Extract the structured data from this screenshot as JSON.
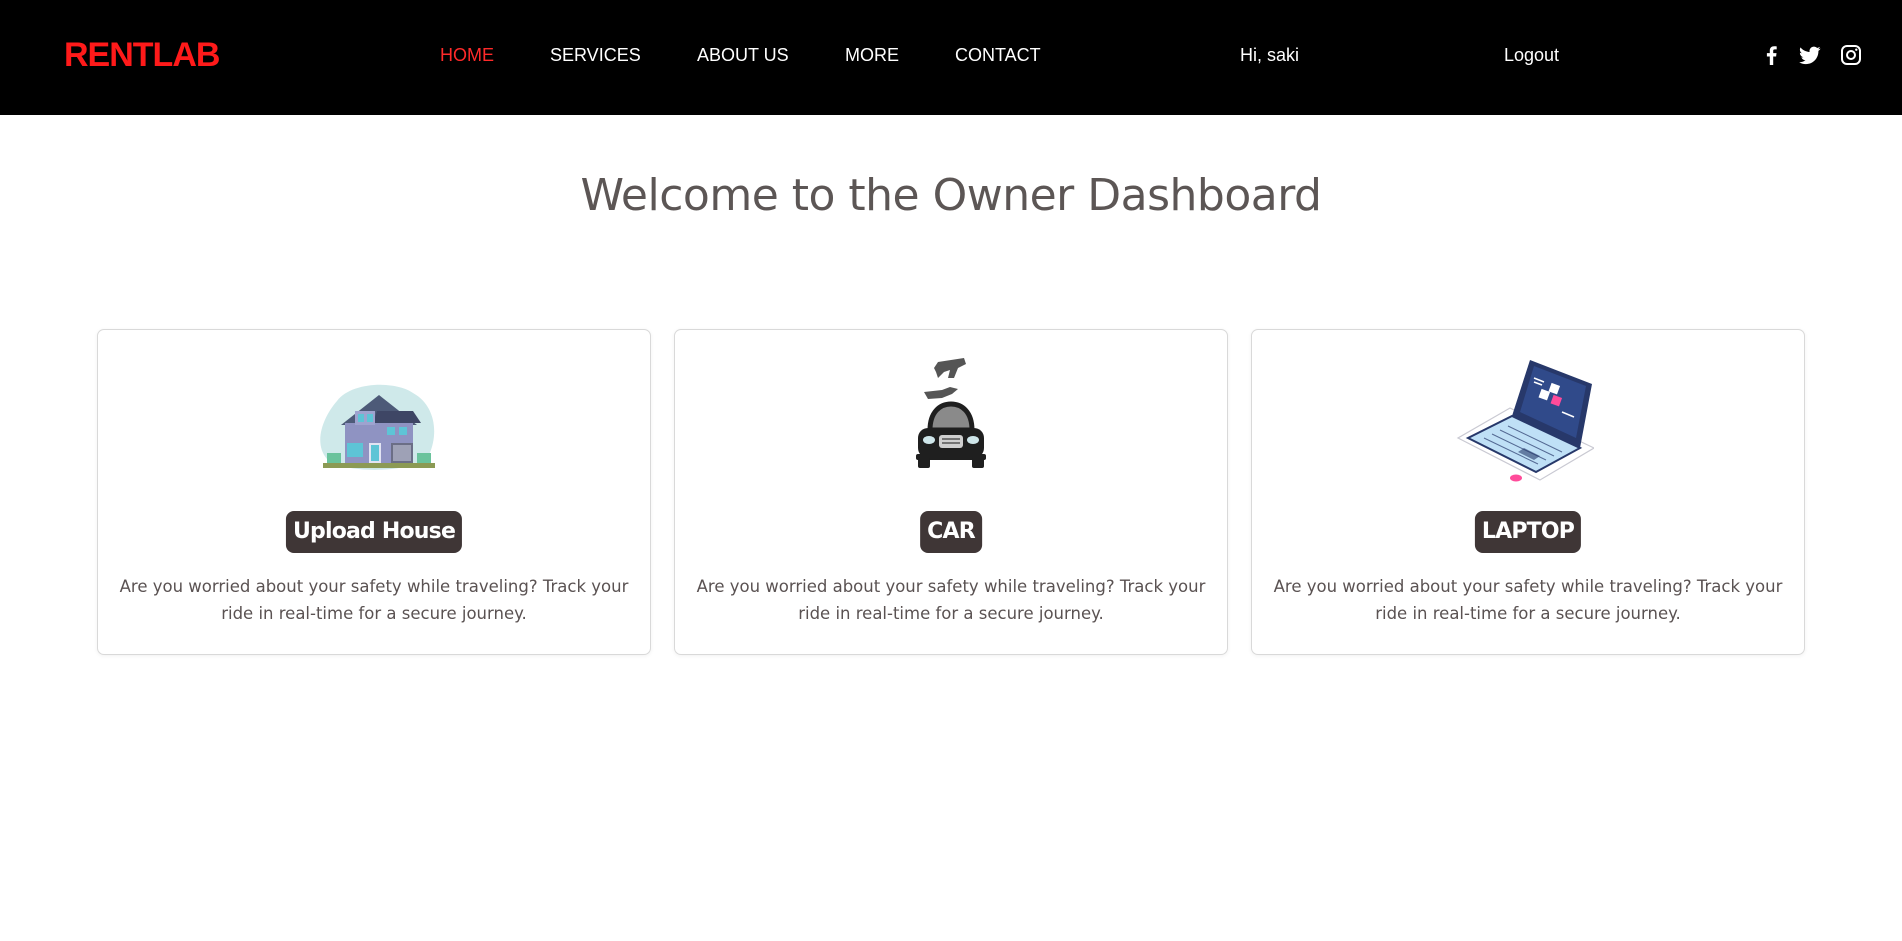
{
  "header": {
    "logo": "RENTLAB",
    "nav": [
      {
        "label": "HOME",
        "active": true
      },
      {
        "label": "SERVICES",
        "active": false
      },
      {
        "label": "ABOUT US",
        "active": false
      },
      {
        "label": "MORE",
        "active": false
      },
      {
        "label": "CONTACT",
        "active": false
      }
    ],
    "greeting": "Hi, saki",
    "logout": "Logout",
    "social_icons": [
      "facebook-icon",
      "twitter-icon",
      "instagram-icon"
    ]
  },
  "main": {
    "title": "Welcome to the Owner Dashboard",
    "cards": [
      {
        "label": "Upload House",
        "icon": "house-illustration",
        "description": "Are you worried about your safety while traveling? Track your ride in real-time for a secure journey."
      },
      {
        "label": "CAR",
        "icon": "car-key-illustration",
        "description": "Are you worried about your safety while traveling? Track your ride in real-time for a secure journey."
      },
      {
        "label": "LAPTOP",
        "icon": "laptop-illustration",
        "description": "Are you worried about your safety while traveling? Track your ride in real-time for a secure journey."
      }
    ]
  },
  "colors": {
    "header_bg": "#000000",
    "brand_red": "#ff1a1a",
    "label_bg": "#3f3636",
    "title_text": "#5c5655"
  }
}
